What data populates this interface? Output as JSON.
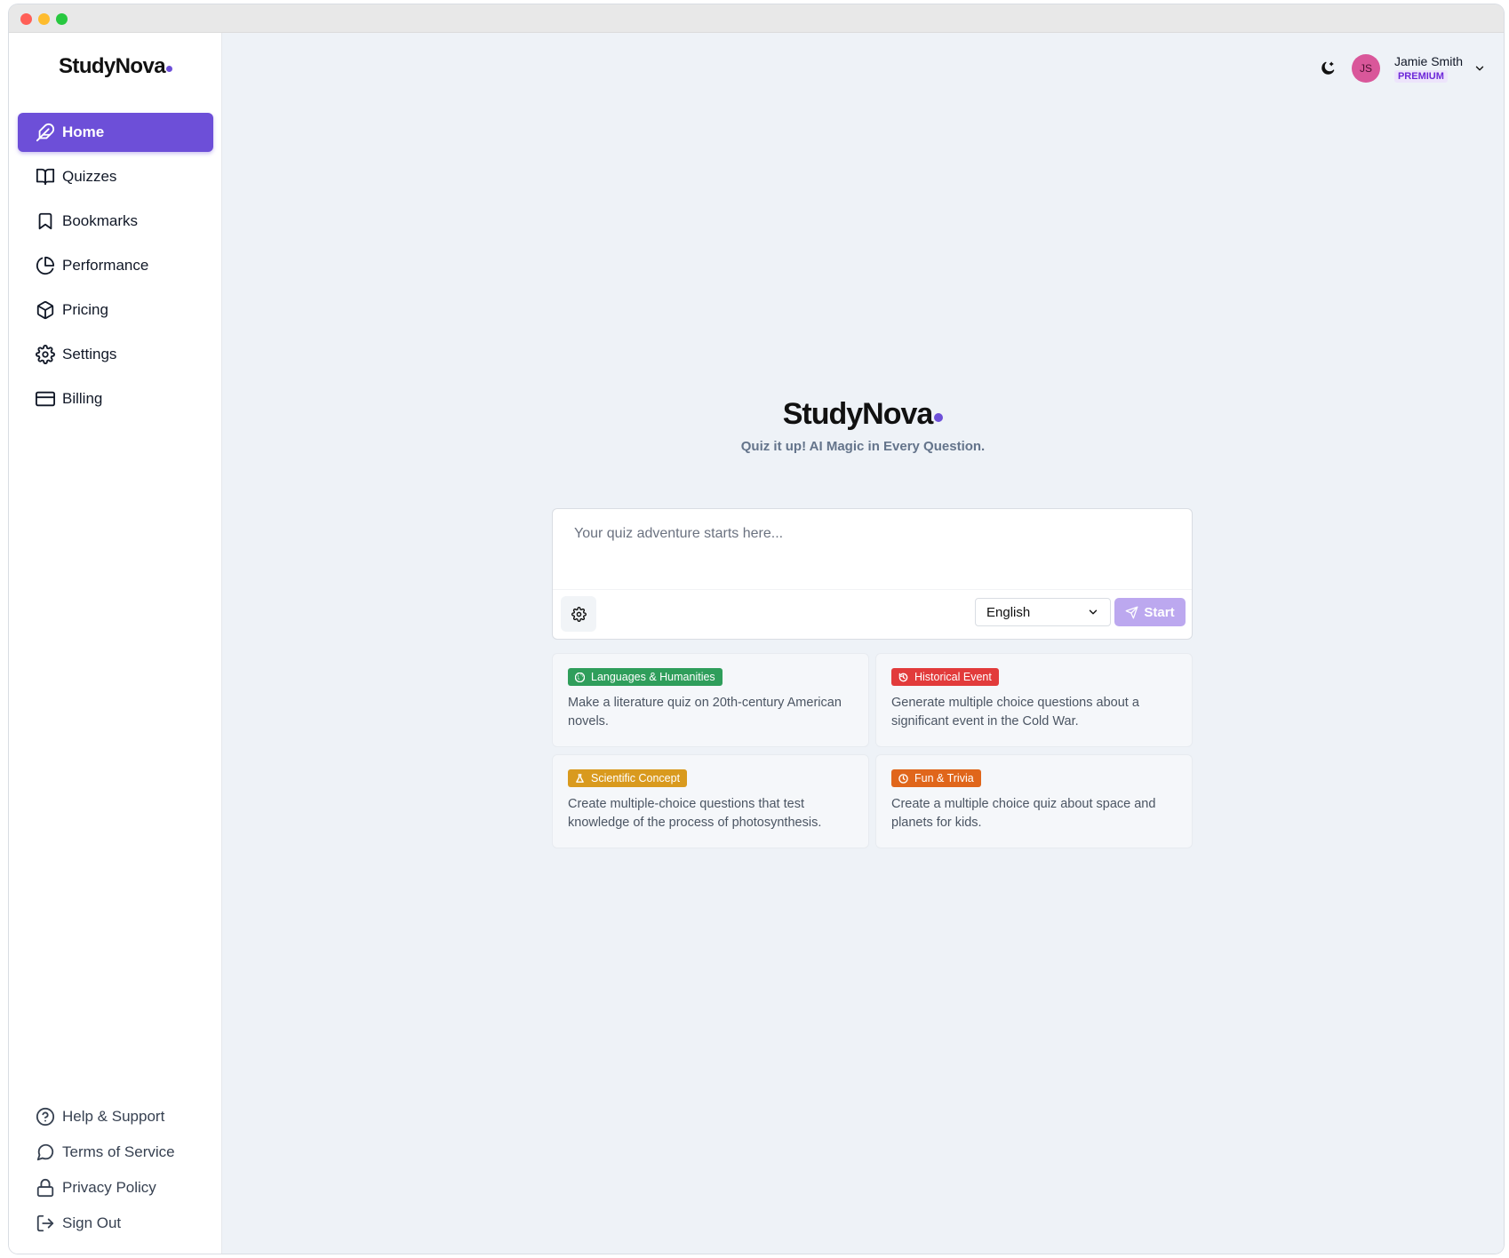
{
  "brand": {
    "name": "StudyNova",
    "accent": "#6d4fd8"
  },
  "sidebar": {
    "items": [
      {
        "label": "Home",
        "icon": "feather-icon",
        "active": true
      },
      {
        "label": "Quizzes",
        "icon": "book-open-icon"
      },
      {
        "label": "Bookmarks",
        "icon": "bookmark-icon"
      },
      {
        "label": "Performance",
        "icon": "pie-chart-icon"
      },
      {
        "label": "Pricing",
        "icon": "box-icon"
      },
      {
        "label": "Settings",
        "icon": "gear-icon"
      },
      {
        "label": "Billing",
        "icon": "credit-card-icon"
      }
    ],
    "footer": [
      {
        "label": "Help & Support",
        "icon": "help-circle-icon"
      },
      {
        "label": "Terms of Service",
        "icon": "message-circle-icon"
      },
      {
        "label": "Privacy Policy",
        "icon": "lock-icon"
      },
      {
        "label": "Sign Out",
        "icon": "log-out-icon"
      }
    ]
  },
  "header": {
    "user": {
      "initials": "JS",
      "name": "Jamie Smith",
      "plan": "PREMIUM"
    }
  },
  "hero": {
    "title": "StudyNova",
    "tagline": "Quiz it up! AI Magic in Every Question."
  },
  "composer": {
    "placeholder": "Your quiz adventure starts here...",
    "language": "English",
    "start_label": "Start"
  },
  "suggestions": [
    {
      "tag": "Languages & Humanities",
      "color": "#2f9e5b",
      "icon": "globe-icon",
      "text": "Make a literature quiz on 20th-century American novels."
    },
    {
      "tag": "Historical Event",
      "color": "#e23b3b",
      "icon": "history-icon",
      "text": "Generate multiple choice questions about a significant event in the Cold War."
    },
    {
      "tag": "Scientific Concept",
      "color": "#d99a1e",
      "icon": "flask-icon",
      "text": "Create multiple-choice questions that test knowledge of the process of photosynthesis."
    },
    {
      "tag": "Fun & Trivia",
      "color": "#e0661b",
      "icon": "clock-icon",
      "text": "Create a multiple choice quiz about space and planets for kids."
    }
  ]
}
